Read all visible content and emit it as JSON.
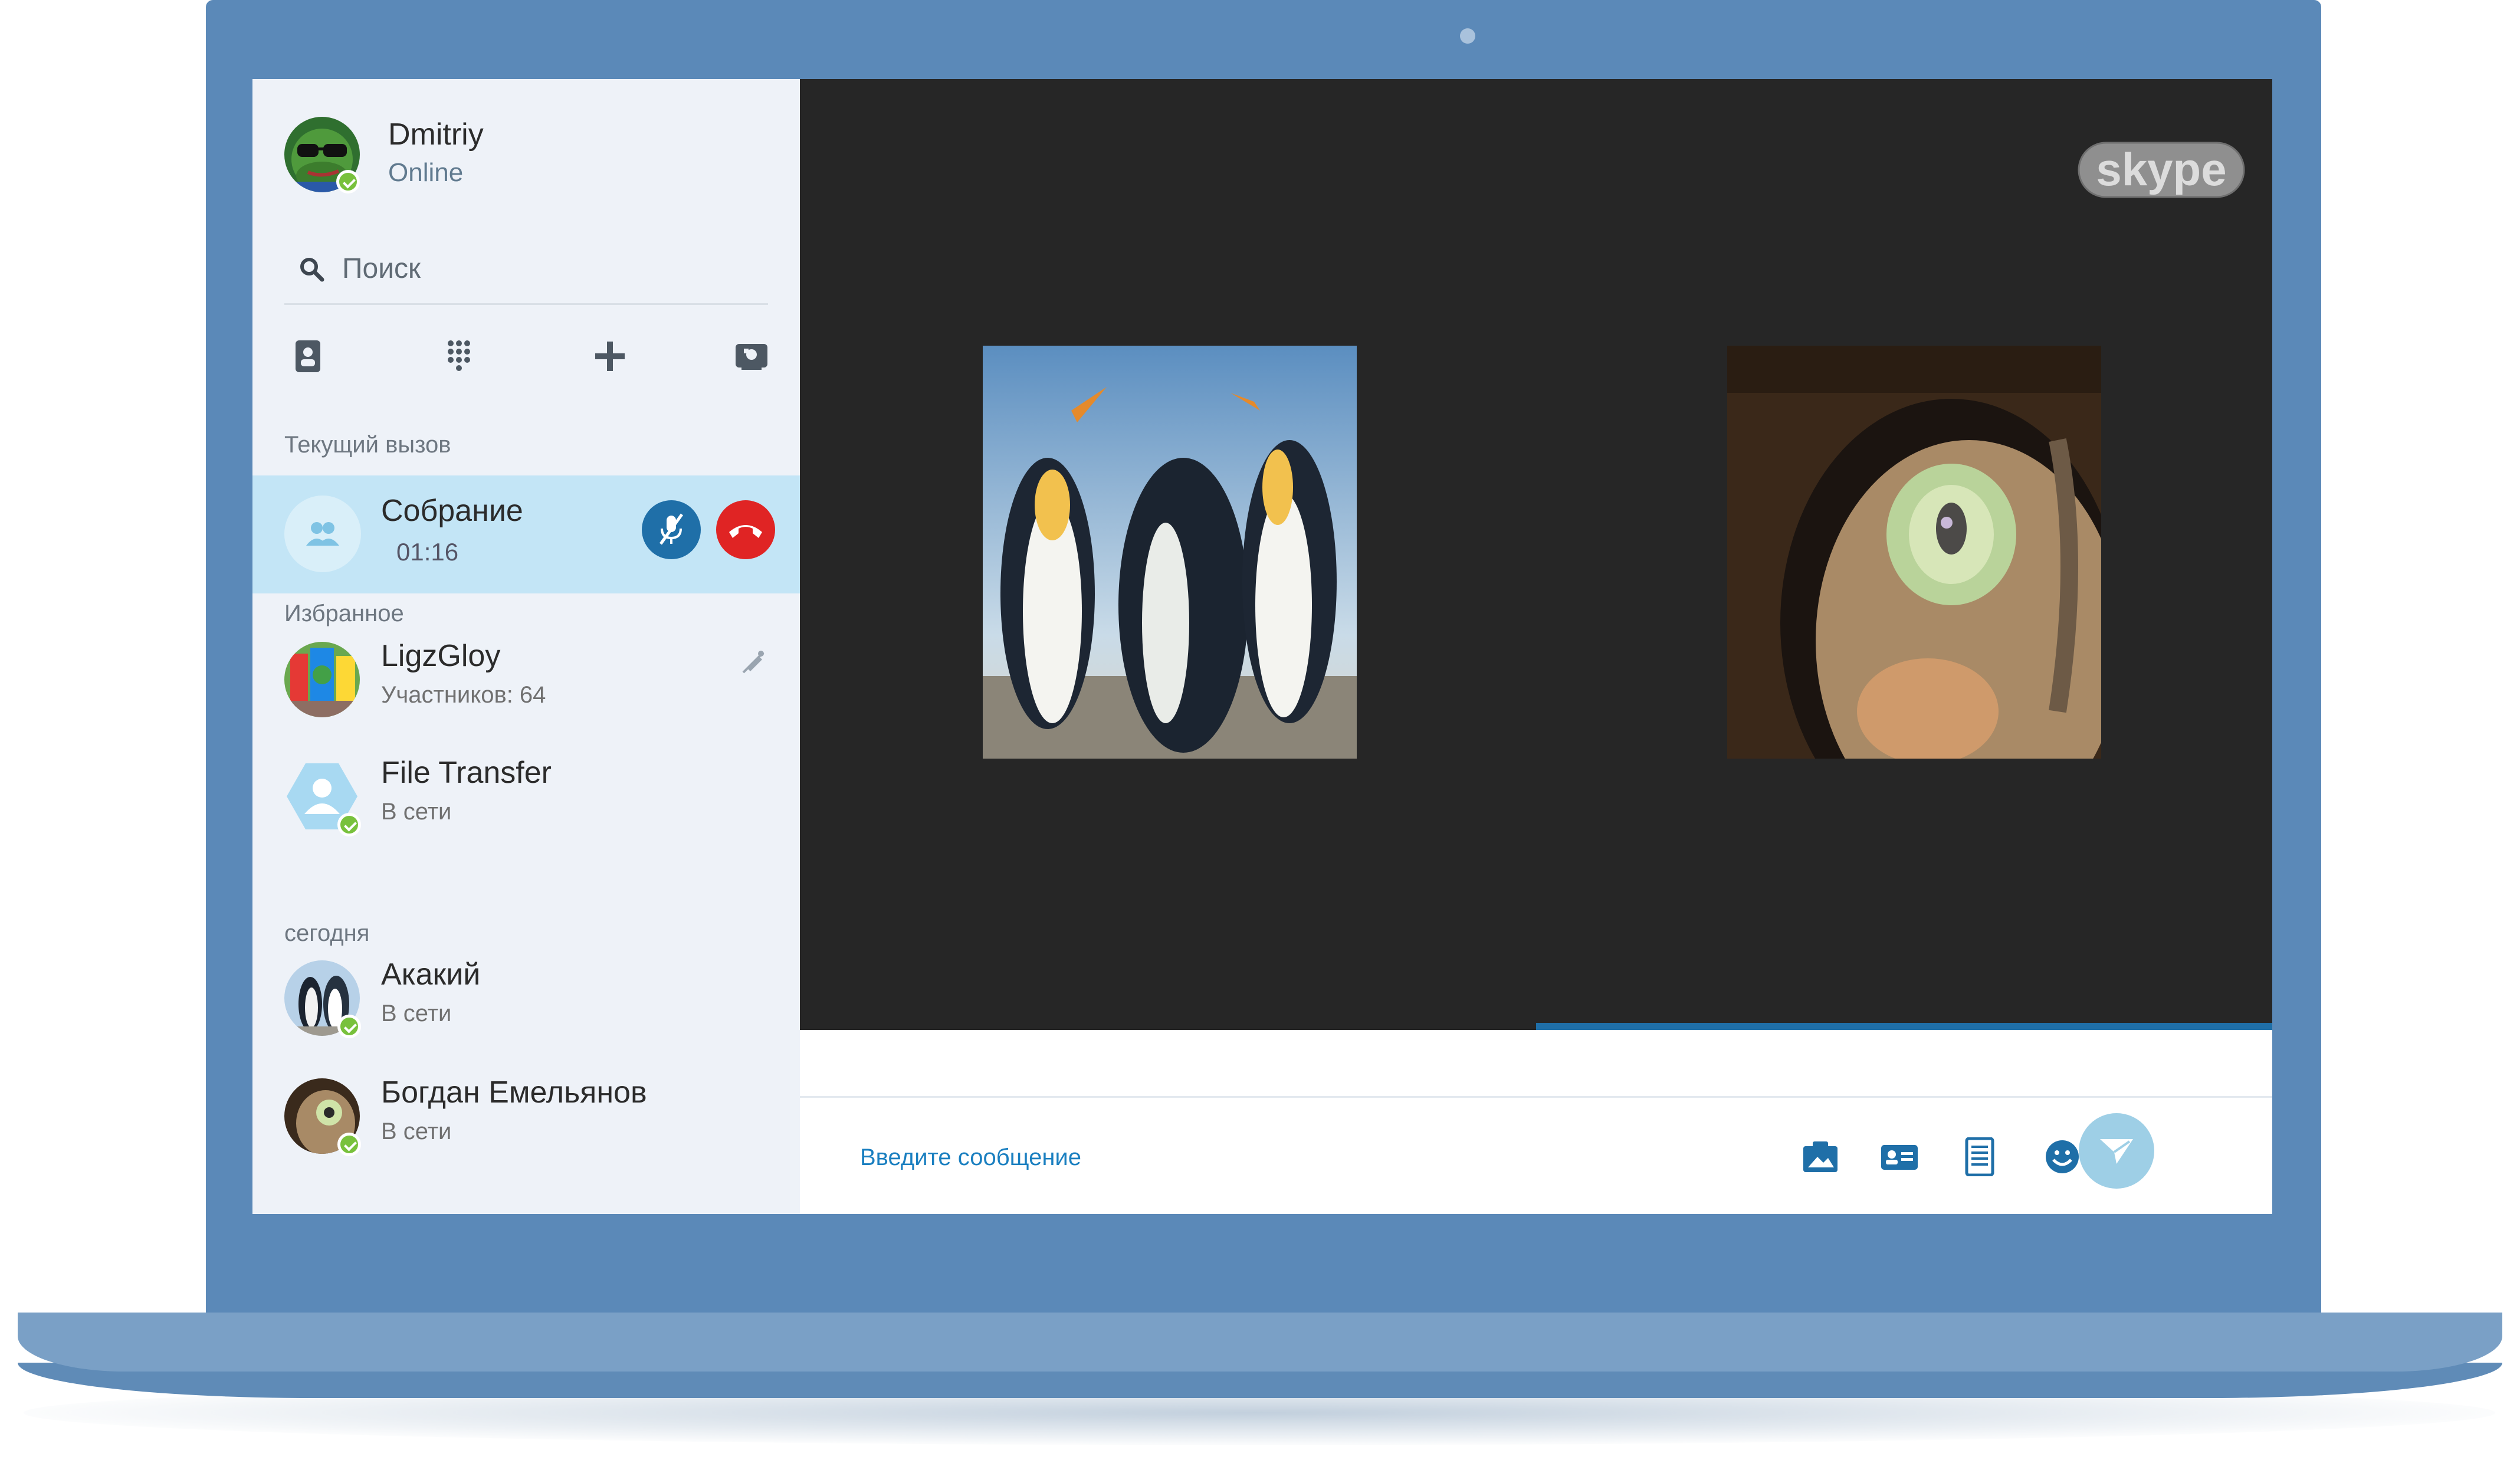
{
  "profile": {
    "name": "Dmitriy",
    "status": "Online"
  },
  "search": {
    "placeholder": "Поиск"
  },
  "toolbar": {
    "icons": [
      "contacts-icon",
      "dialpad-icon",
      "add-icon",
      "new-call-icon"
    ]
  },
  "sections": {
    "current_call": "Текущий вызов",
    "favorites": "Избранное",
    "today": "сегодня"
  },
  "current_call": {
    "name": "Собрание",
    "duration": "01:16"
  },
  "favorites": [
    {
      "name": "LigzGloy",
      "subtitle": "Участников: 64",
      "muted": true
    },
    {
      "name": "File Transfer",
      "subtitle": "В сети"
    }
  ],
  "today": [
    {
      "name": "Акакий",
      "subtitle": "В сети"
    },
    {
      "name": "Богдан Емельянов",
      "subtitle": "В сети"
    }
  ],
  "call": {
    "progress": 0.5
  },
  "composer": {
    "placeholder": "Введите сообщение"
  },
  "colors": {
    "accent": "#1f6fa8",
    "online": "#78c13c",
    "hangup": "#e02424",
    "call_bg": "#262626",
    "frame": "#5b89b8"
  }
}
